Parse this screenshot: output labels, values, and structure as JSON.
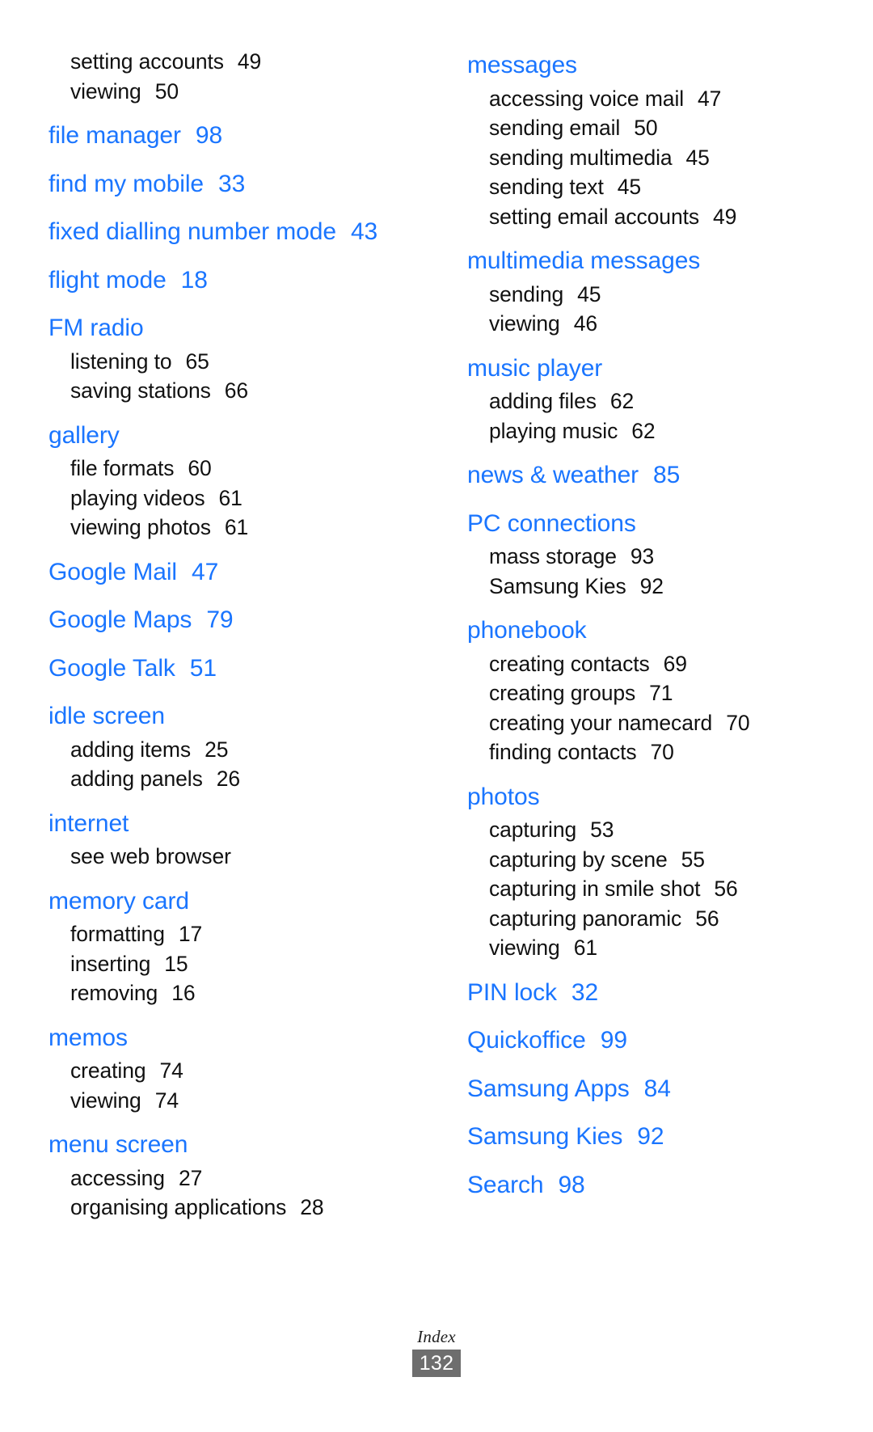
{
  "page": {
    "footer_label": "Index",
    "footer_page_number": "132",
    "headword_color": "#1a75ff",
    "subentry_color": "#111111",
    "footer_box_color": "#6e6e6e"
  },
  "columns": [
    {
      "name": "left",
      "groups": [
        {
          "headword": null,
          "subentries": [
            {
              "label": "setting accounts",
              "page": "49"
            },
            {
              "label": "viewing",
              "page": "50"
            }
          ]
        },
        {
          "headword": "file manager",
          "headword_page": "98",
          "subentries": []
        },
        {
          "headword": "find my mobile",
          "headword_page": "33",
          "subentries": []
        },
        {
          "headword": "fixed dialling number mode",
          "headword_page": "43",
          "subentries": []
        },
        {
          "headword": "flight mode",
          "headword_page": "18",
          "subentries": []
        },
        {
          "headword": "FM radio",
          "headword_page": null,
          "subentries": [
            {
              "label": "listening to",
              "page": "65"
            },
            {
              "label": "saving stations",
              "page": "66"
            }
          ]
        },
        {
          "headword": "gallery",
          "headword_page": null,
          "subentries": [
            {
              "label": "file formats",
              "page": "60"
            },
            {
              "label": "playing videos",
              "page": "61"
            },
            {
              "label": "viewing photos",
              "page": "61"
            }
          ]
        },
        {
          "headword": "Google Mail",
          "headword_page": "47",
          "subentries": []
        },
        {
          "headword": "Google Maps",
          "headword_page": "79",
          "subentries": []
        },
        {
          "headword": "Google Talk",
          "headword_page": "51",
          "subentries": []
        },
        {
          "headword": "idle screen",
          "headword_page": null,
          "subentries": [
            {
              "label": "adding items",
              "page": "25"
            },
            {
              "label": "adding panels",
              "page": "26"
            }
          ]
        },
        {
          "headword": "internet",
          "headword_page": null,
          "subentries": [
            {
              "label": "see web browser",
              "page": ""
            }
          ]
        },
        {
          "headword": "memory card",
          "headword_page": null,
          "subentries": [
            {
              "label": "formatting",
              "page": "17"
            },
            {
              "label": "inserting",
              "page": "15"
            },
            {
              "label": "removing",
              "page": "16"
            }
          ]
        },
        {
          "headword": "memos",
          "headword_page": null,
          "subentries": [
            {
              "label": "creating",
              "page": "74"
            },
            {
              "label": "viewing",
              "page": "74"
            }
          ]
        },
        {
          "headword": "menu screen",
          "headword_page": null,
          "subentries": [
            {
              "label": "accessing",
              "page": "27"
            },
            {
              "label": "organising applications",
              "page": "28"
            }
          ]
        }
      ]
    },
    {
      "name": "right",
      "groups": [
        {
          "headword": "messages",
          "headword_page": null,
          "subentries": [
            {
              "label": "accessing voice mail",
              "page": "47"
            },
            {
              "label": "sending email",
              "page": "50"
            },
            {
              "label": "sending multimedia",
              "page": "45"
            },
            {
              "label": "sending text",
              "page": "45"
            },
            {
              "label": "setting email accounts",
              "page": "49"
            }
          ]
        },
        {
          "headword": "multimedia messages",
          "headword_page": null,
          "subentries": [
            {
              "label": "sending",
              "page": "45"
            },
            {
              "label": "viewing",
              "page": "46"
            }
          ]
        },
        {
          "headword": "music player",
          "headword_page": null,
          "subentries": [
            {
              "label": "adding files",
              "page": "62"
            },
            {
              "label": "playing music",
              "page": "62"
            }
          ]
        },
        {
          "headword": "news & weather",
          "headword_page": "85",
          "subentries": []
        },
        {
          "headword": "PC connections",
          "headword_page": null,
          "subentries": [
            {
              "label": "mass storage",
              "page": "93"
            },
            {
              "label": "Samsung Kies",
              "page": "92"
            }
          ]
        },
        {
          "headword": "phonebook",
          "headword_page": null,
          "subentries": [
            {
              "label": "creating contacts",
              "page": "69"
            },
            {
              "label": "creating groups",
              "page": "71"
            },
            {
              "label": "creating your namecard",
              "page": "70"
            },
            {
              "label": "finding contacts",
              "page": "70"
            }
          ]
        },
        {
          "headword": "photos",
          "headword_page": null,
          "subentries": [
            {
              "label": "capturing",
              "page": "53"
            },
            {
              "label": "capturing by scene",
              "page": "55"
            },
            {
              "label": "capturing in smile shot",
              "page": "56"
            },
            {
              "label": "capturing panoramic",
              "page": "56"
            },
            {
              "label": "viewing",
              "page": "61"
            }
          ]
        },
        {
          "headword": "PIN lock",
          "headword_page": "32",
          "subentries": []
        },
        {
          "headword": "Quickoffice",
          "headword_page": "99",
          "subentries": []
        },
        {
          "headword": "Samsung Apps",
          "headword_page": "84",
          "subentries": []
        },
        {
          "headword": "Samsung Kies",
          "headword_page": "92",
          "subentries": []
        },
        {
          "headword": "Search",
          "headword_page": "98",
          "subentries": []
        }
      ]
    }
  ]
}
